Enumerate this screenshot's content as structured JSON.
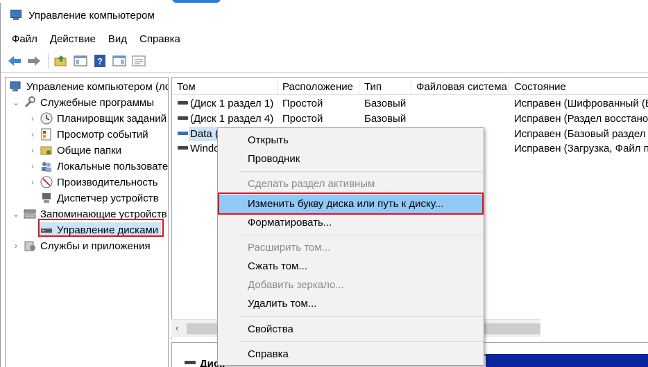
{
  "window": {
    "title": "Управление компьютером"
  },
  "menu": [
    "Файл",
    "Действие",
    "Вид",
    "Справка"
  ],
  "tree": {
    "root": "Управление компьютером (лс",
    "system_tools": "Служебные программы",
    "task_scheduler": "Планировщик заданий",
    "event_viewer": "Просмотр событий",
    "shared_folders": "Общие папки",
    "local_users": "Локальные пользовате",
    "performance": "Производительность",
    "device_manager": "Диспетчер устройств",
    "storage": "Запоминающие устройств",
    "disk_management": "Управление дисками",
    "services_apps": "Службы и приложения"
  },
  "table": {
    "columns": [
      "Том",
      "Расположение",
      "Тип",
      "Файловая система",
      "Состояние"
    ],
    "rows": [
      {
        "volume": "(Диск 1 раздел 1)",
        "layout": "Простой",
        "type": "Базовый",
        "fs": "",
        "status": "Исправен (Шифрованный (E"
      },
      {
        "volume": "(Диск 1 раздел 4)",
        "layout": "Простой",
        "type": "Базовый",
        "fs": "",
        "status": "Исправен (Раздел восстанов"
      },
      {
        "volume": "Data (",
        "layout": "",
        "type": "",
        "fs": "",
        "status": "Исправен (Базовый раздел д"
      },
      {
        "volume": "Windo",
        "layout": "",
        "type": "",
        "fs": "",
        "status": "Исправен (Загрузка, Файл по"
      }
    ]
  },
  "bottom": {
    "disk_label": "Диск"
  },
  "context_menu": {
    "open": "Открыть",
    "explorer": "Проводник",
    "mark_active": "Сделать раздел активным",
    "change_letter": "Изменить букву диска или путь к диску...",
    "format": "Форматировать...",
    "extend": "Расширить том...",
    "shrink": "Сжать том...",
    "add_mirror": "Добавить зеркало...",
    "delete": "Удалить том...",
    "properties": "Свойства",
    "help": "Справка"
  },
  "colors": {
    "highlight_red": "#e0151a",
    "menu_hover": "#91c9f7",
    "selection": "#cce4f7"
  }
}
